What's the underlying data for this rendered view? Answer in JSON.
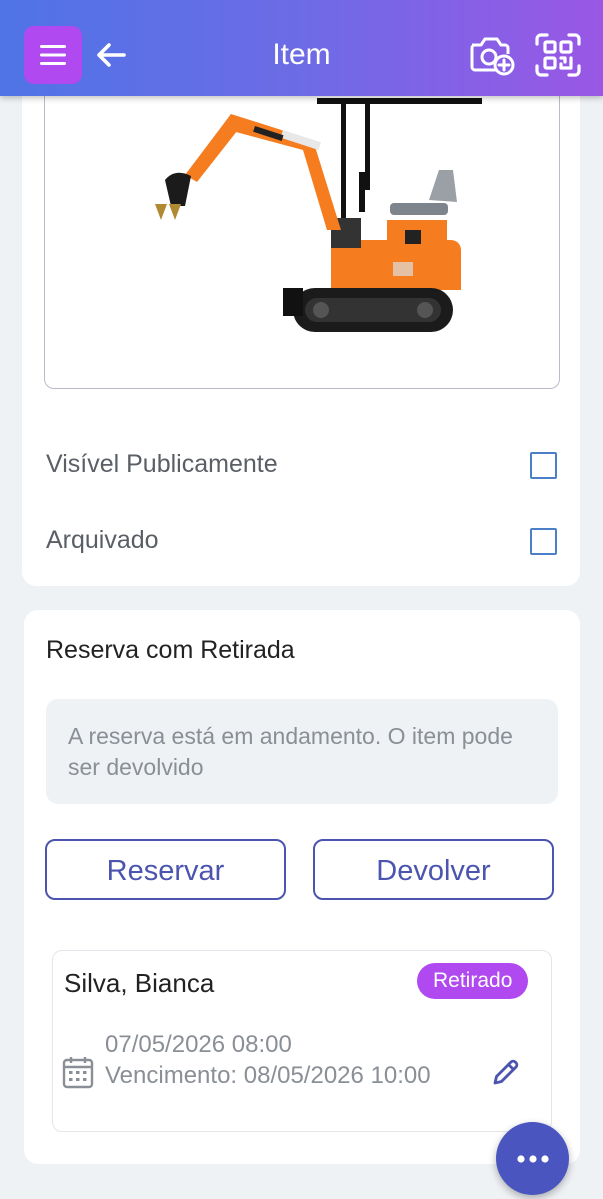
{
  "header": {
    "title": "Item",
    "menu_icon": "hamburger-menu-icon",
    "back_icon": "arrow-left-icon",
    "camera_icon": "camera-plus-icon",
    "scan_icon": "qr-scan-icon",
    "colors": {
      "gradient_start": "#4f74e6",
      "gradient_end": "#9a57e6",
      "menu_button": "#b04af0"
    }
  },
  "item": {
    "image": "excavator-photo",
    "options": [
      {
        "label": "Visível Publicamente",
        "checked": false
      },
      {
        "label": "Arquivado",
        "checked": false
      }
    ]
  },
  "reservation": {
    "title": "Reserva com Retirada",
    "notice": "A reserva está em andamento. O item pode ser devolvido",
    "reserve_label": "Reservar",
    "return_label": "Devolver",
    "booking": {
      "name": "Silva, Bianca",
      "status": "Retirado",
      "start": "07/05/2026 08:00",
      "due": "Vencimento: 08/05/2026 10:00",
      "calendar_icon": "calendar-icon",
      "edit_icon": "pencil-icon"
    }
  },
  "fab": {
    "icon": "more-horizontal-icon"
  },
  "accent_colors": {
    "primary": "#4b55b0",
    "status_badge": "#b04af0"
  }
}
